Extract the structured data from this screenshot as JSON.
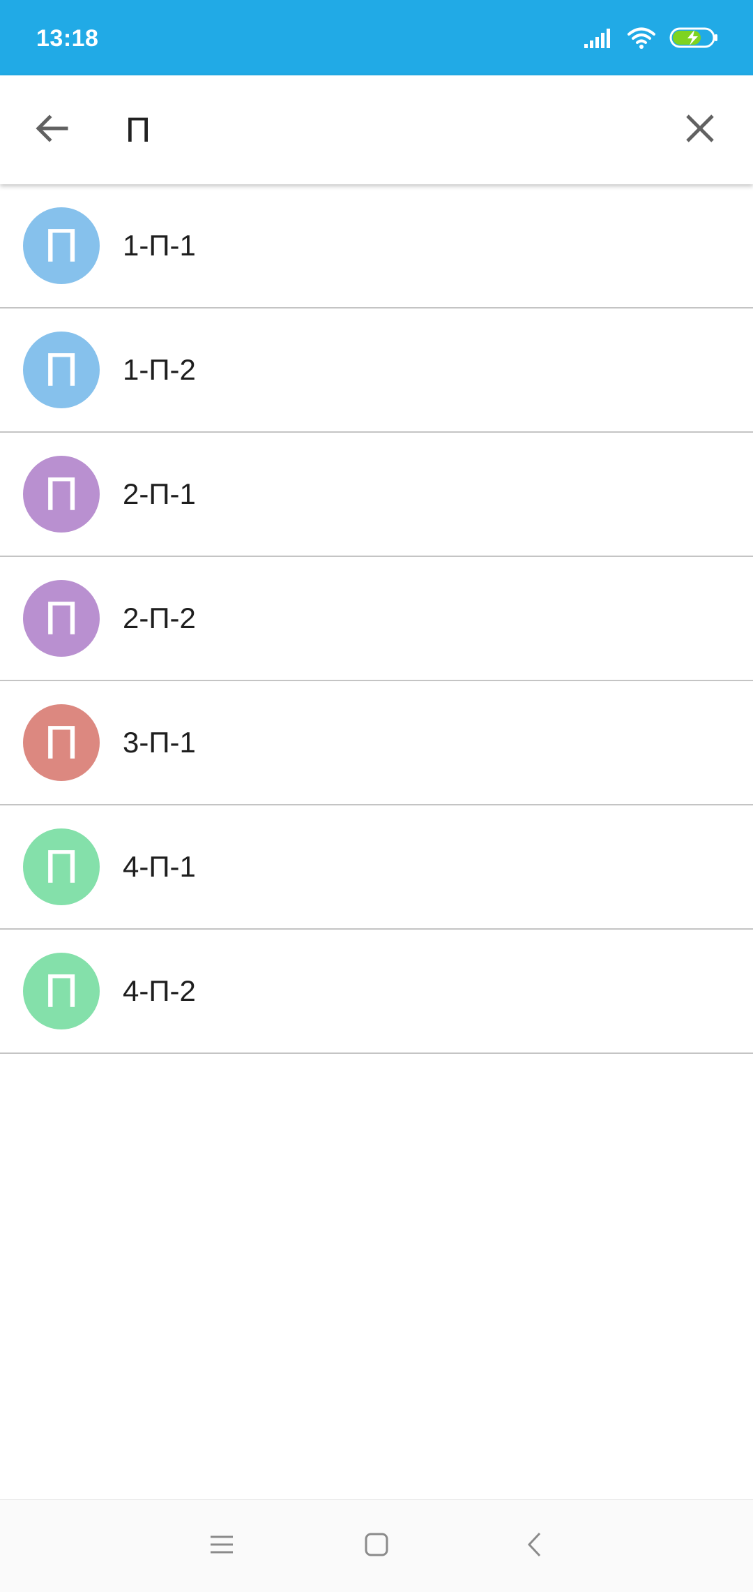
{
  "status_bar": {
    "time": "13:18",
    "background": "#21aae6",
    "icons": [
      "signal-icon",
      "wifi-icon",
      "battery-charging-icon"
    ]
  },
  "search": {
    "query": "П",
    "back_icon": "arrow-back-icon",
    "clear_icon": "close-icon"
  },
  "results": [
    {
      "avatar_letter": "П",
      "label": "1-П-1",
      "avatar_color": "#86c1ec"
    },
    {
      "avatar_letter": "П",
      "label": "1-П-2",
      "avatar_color": "#86c1ec"
    },
    {
      "avatar_letter": "П",
      "label": "2-П-1",
      "avatar_color": "#b990d0"
    },
    {
      "avatar_letter": "П",
      "label": "2-П-2",
      "avatar_color": "#b990d0"
    },
    {
      "avatar_letter": "П",
      "label": "3-П-1",
      "avatar_color": "#dc8880"
    },
    {
      "avatar_letter": "П",
      "label": "4-П-1",
      "avatar_color": "#84e0aa"
    },
    {
      "avatar_letter": "П",
      "label": "4-П-2",
      "avatar_color": "#84e0aa"
    }
  ],
  "nav_bar": {
    "icons": [
      "menu-icon",
      "home-icon",
      "back-chevron-icon"
    ]
  }
}
